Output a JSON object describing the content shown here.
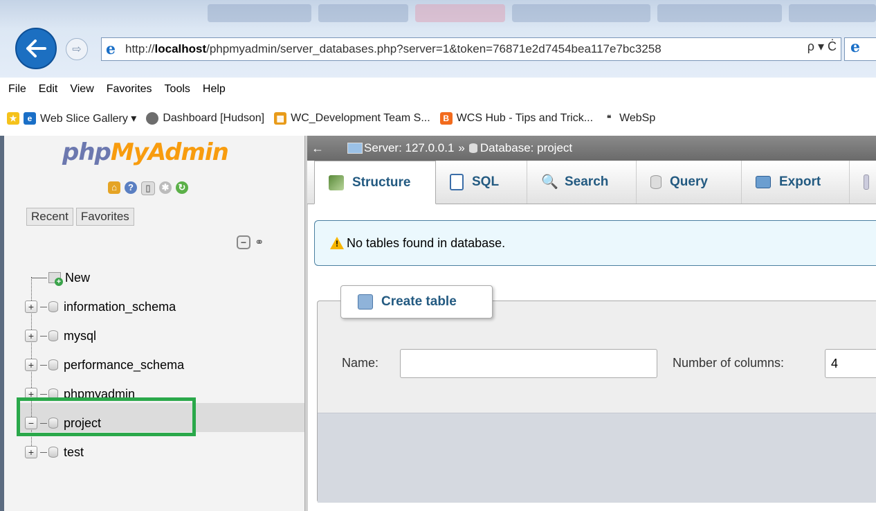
{
  "browser": {
    "url_prefix": "http://",
    "url_host": "localhost",
    "url_rest": "/phpmyadmin/server_databases.php?server=1&token=76871e2d7454bea117e7bc3258",
    "url_tools": "ρ ▾ Ċ",
    "menu": [
      "File",
      "Edit",
      "View",
      "Favorites",
      "Tools",
      "Help"
    ],
    "favorites": [
      {
        "label": "Web Slice Gallery ▾",
        "icon": "ie-icon",
        "color": "#1a6fc7"
      },
      {
        "label": "Dashboard [Hudson]",
        "icon": "hudson-icon",
        "color": "#6d6d6d"
      },
      {
        "label": "WC_Development Team S...",
        "icon": "sharepoint-icon",
        "color": "#e89b1a"
      },
      {
        "label": "WCS Hub - Tips and Trick...",
        "icon": "blogger-icon",
        "color": "#f26b1d"
      },
      {
        "label": "WebSp",
        "icon": "websphere-icon",
        "color": "#333333"
      }
    ]
  },
  "nav": {
    "logo_prefix": "php",
    "logo_highlight": "MyAdmin",
    "tabs": [
      "Recent",
      "Favorites"
    ],
    "tree": [
      {
        "label": "New",
        "expander": ""
      },
      {
        "label": "information_schema",
        "expander": "+"
      },
      {
        "label": "mysql",
        "expander": "+"
      },
      {
        "label": "performance_schema",
        "expander": "+"
      },
      {
        "label": "phpmyadmin",
        "expander": "+"
      },
      {
        "label": "project",
        "expander": "−"
      },
      {
        "label": "test",
        "expander": "+"
      }
    ],
    "selected": "project",
    "highlight_color": "#2aa84a"
  },
  "main": {
    "breadcrumb": {
      "back": "←",
      "server": "Server: 127.0.0.1",
      "sep": "»",
      "database": "Database: project"
    },
    "tabs": [
      "Structure",
      "SQL",
      "Search",
      "Query",
      "Export"
    ],
    "active_tab": "Structure",
    "notice": "No tables found in database.",
    "create": {
      "legend": "Create table",
      "name_label": "Name:",
      "name_value": "",
      "cols_label": "Number of columns:",
      "cols_value": "4"
    }
  }
}
